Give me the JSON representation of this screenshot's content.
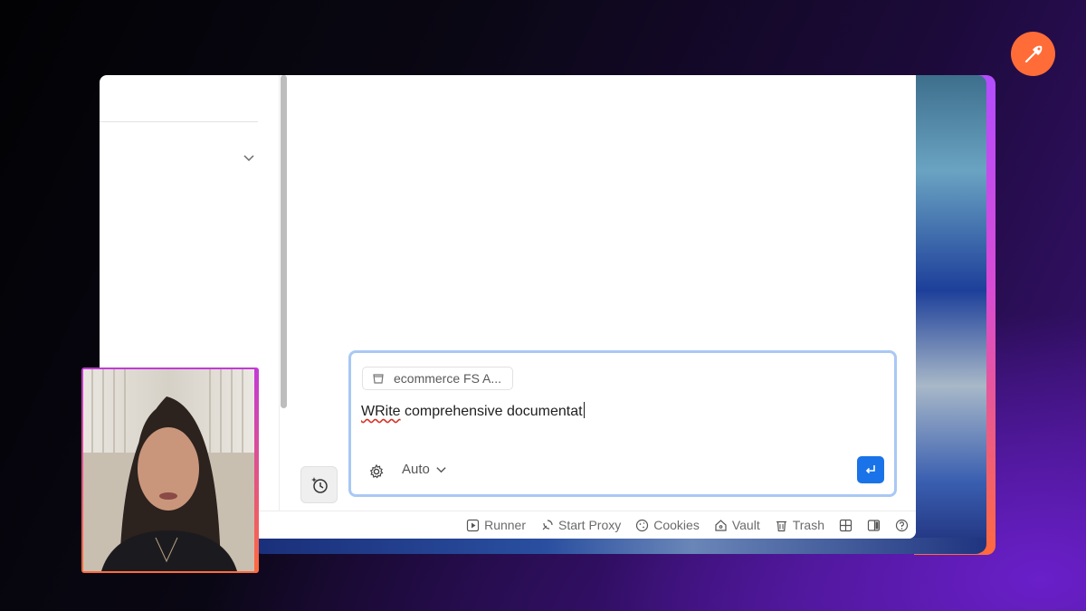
{
  "prompt": {
    "context_chip": "ecommerce FS A...",
    "text_misspelled": "WRite",
    "text_rest": " comprehensive documentat",
    "mode": "Auto"
  },
  "status_bar": {
    "runner": "Runner",
    "start_proxy": "Start Proxy",
    "cookies": "Cookies",
    "vault": "Vault",
    "trash": "Trash"
  },
  "colors": {
    "accent_blue": "#1a73e8",
    "prompt_border": "#a9c8f4",
    "postman_orange": "#ff6c37"
  },
  "icons": [
    "chevron-down-icon",
    "sparkle-history-icon",
    "collection-icon",
    "gear-icon",
    "chevron-down-icon",
    "enter-icon",
    "play-icon",
    "satellite-icon",
    "cookie-icon",
    "vault-icon",
    "trash-icon",
    "grid-layout-icon",
    "two-pane-icon",
    "help-icon",
    "postman-logo"
  ]
}
